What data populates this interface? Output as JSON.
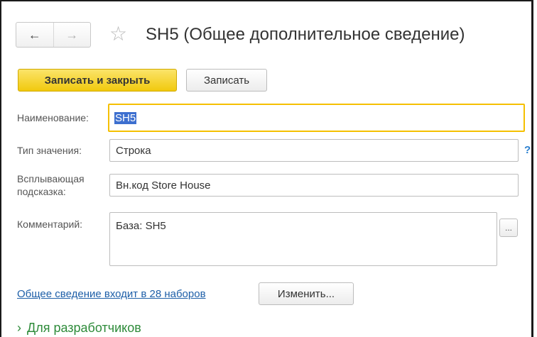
{
  "header": {
    "title": "SH5 (Общее дополнительное сведение)",
    "back_icon": "←",
    "forward_icon": "→",
    "star_icon": "☆"
  },
  "toolbar": {
    "save_close_label": "Записать и закрыть",
    "save_label": "Записать"
  },
  "form": {
    "name": {
      "label": "Наименование:",
      "value": "SH5"
    },
    "value_type": {
      "label": "Тип значения:",
      "value": "Строка",
      "help": "?"
    },
    "tooltip": {
      "label_line1": "Всплывающая",
      "label_line2": "подсказка:",
      "value": "Вн.код Store House"
    },
    "comment": {
      "label": "Комментарий:",
      "value": "База: SH5",
      "choose_button": "..."
    }
  },
  "sets": {
    "link_text": "Общее сведение входит в 28 наборов",
    "change_button": "Изменить..."
  },
  "developers": {
    "chevron": "›",
    "label": "Для разработчиков"
  },
  "colors": {
    "accent_yellow": "#f5c000",
    "link_blue": "#1e5fa8",
    "section_green": "#2e8b3a",
    "selection_blue": "#3d6fcf"
  }
}
